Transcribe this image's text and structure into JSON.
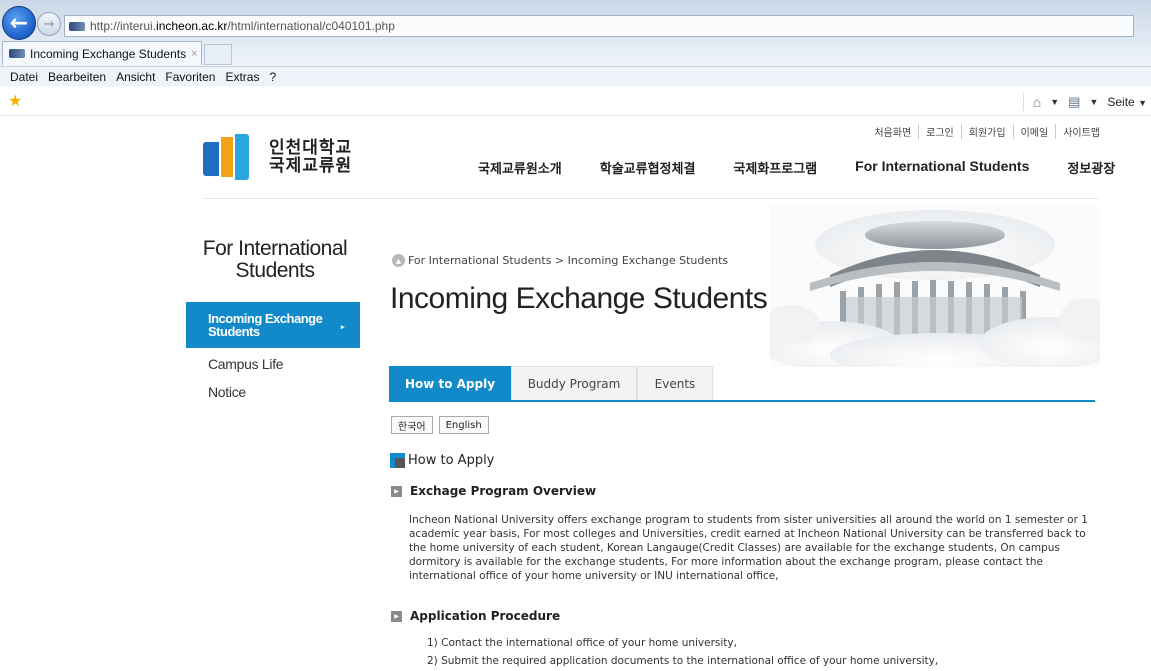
{
  "browser": {
    "url_prefix": "http://interui.",
    "url_host": "incheon.ac.kr",
    "url_path": "/html/international/c040101.php",
    "tab_title": "Incoming Exchange Students",
    "tab_close": "×",
    "menu": [
      "Datei",
      "Bearbeiten",
      "Ansicht",
      "Favoriten",
      "Extras",
      "?"
    ],
    "seite_label": "Seite"
  },
  "header": {
    "logo_line1": "인천대학교",
    "logo_line2": "국제교류원",
    "utility": [
      "처음화면",
      "로그인",
      "회원가입",
      "이메일",
      "사이트맵"
    ],
    "gnb": [
      "국제교류원소개",
      "학술교류협정체결",
      "국제화프로그램",
      "For International Students",
      "정보광장"
    ]
  },
  "sidebar": {
    "title_line1": "For International",
    "title_line2": "Students",
    "active_line1": "Incoming Exchange",
    "active_line2": "Students",
    "active_arrow": "▸",
    "items": [
      "Campus Life",
      "Notice"
    ]
  },
  "main": {
    "breadcrumb": "For International Students > Incoming Exchange Students",
    "title": "Incoming Exchange Students",
    "tabs": [
      "How to Apply",
      "Buddy Program",
      "Events"
    ],
    "lang_buttons": [
      "한국어",
      "English"
    ],
    "section_title": "How to Apply",
    "overview_heading": "Exchage Program Overview",
    "overview_text": "Incheon National University offers exchange program to students from sister universities all around the world on 1 semester or 1 academic year basis, For most colleges and Universities, credit earned at Incheon National University can be transferred back to the home university of each student, Korean Langauge(Credit Classes) are available for the exchange students, On campus dormitory is available for the exchange students, For more information about the exchange program, please contact the international office of your home university or INU international office,",
    "procedure_heading": "Application Procedure",
    "procedure_steps": [
      "1) Contact the international office of your home university,",
      "2) Submit the required application documents to the international office of your home university,"
    ]
  }
}
